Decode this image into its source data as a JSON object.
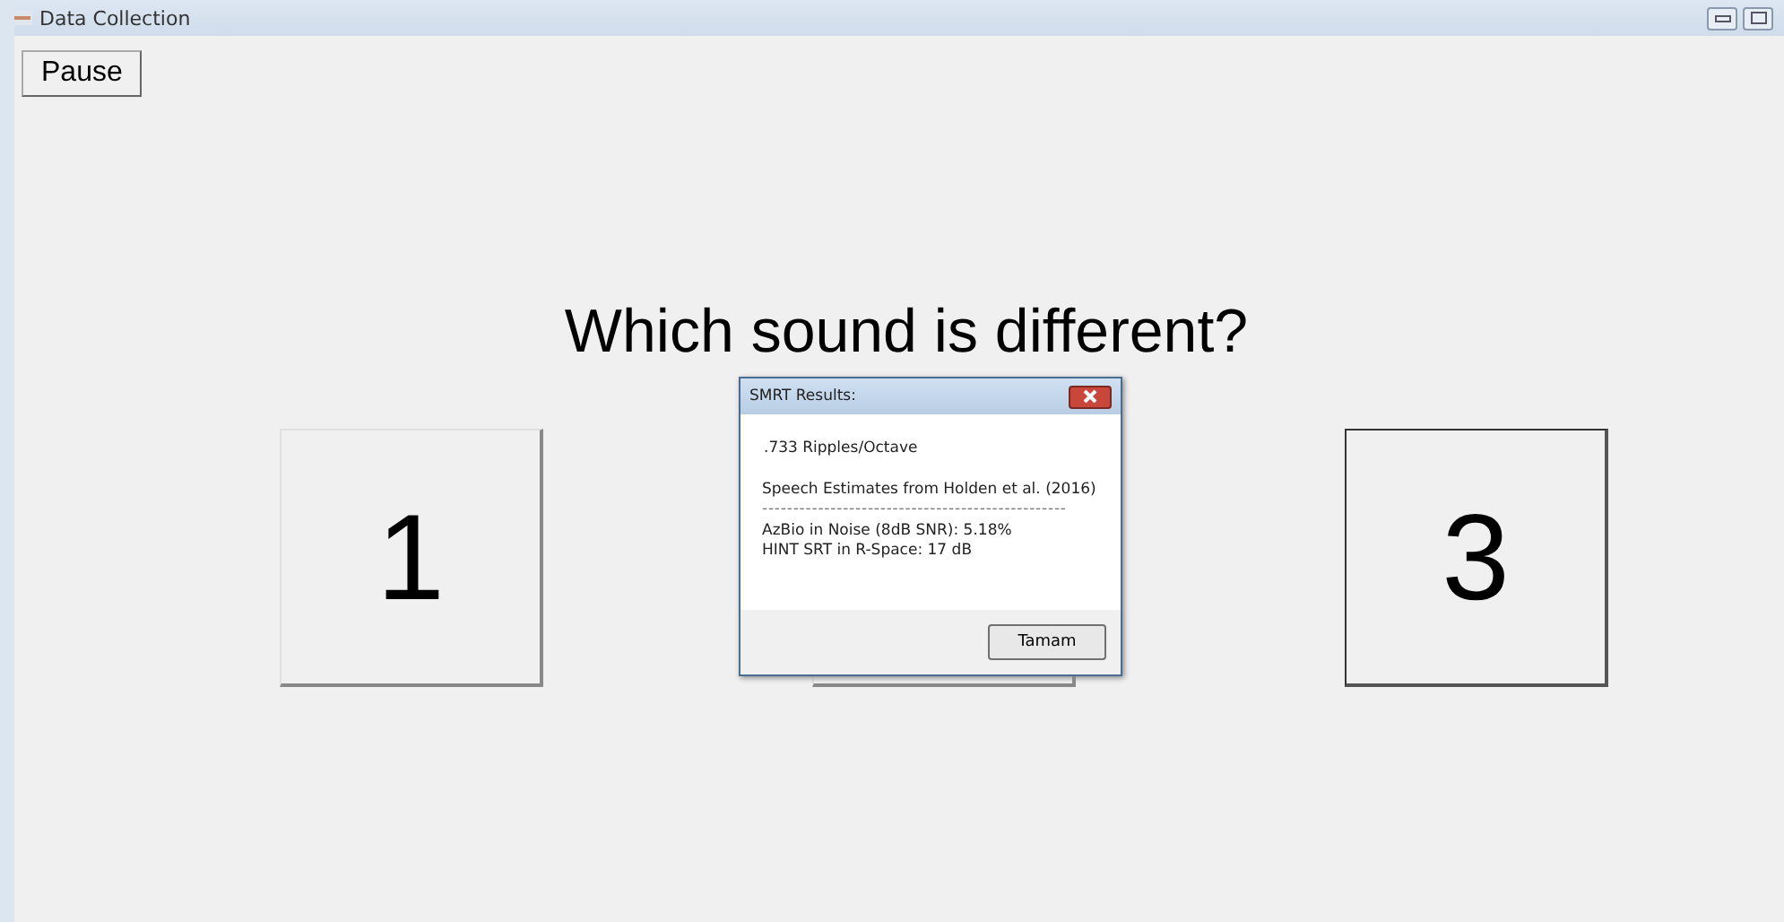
{
  "window": {
    "title": "Data Collection"
  },
  "pause_button": {
    "label": "Pause"
  },
  "question": "Which sound is different?",
  "choices": [
    {
      "label": "1",
      "focused": false
    },
    {
      "focused": false
    },
    {
      "label": "3",
      "focused": true
    }
  ],
  "dialog": {
    "title": "SMRT Results:",
    "lines": [
      ".733 Ripples/Octave",
      "Speech Estimates from Holden et al. (2016)",
      "-------------------------------------------------",
      "AzBio in Noise (8dB SNR):  5.18%",
      "HINT SRT in R-Space:  17 dB"
    ],
    "button": "Tamam"
  }
}
